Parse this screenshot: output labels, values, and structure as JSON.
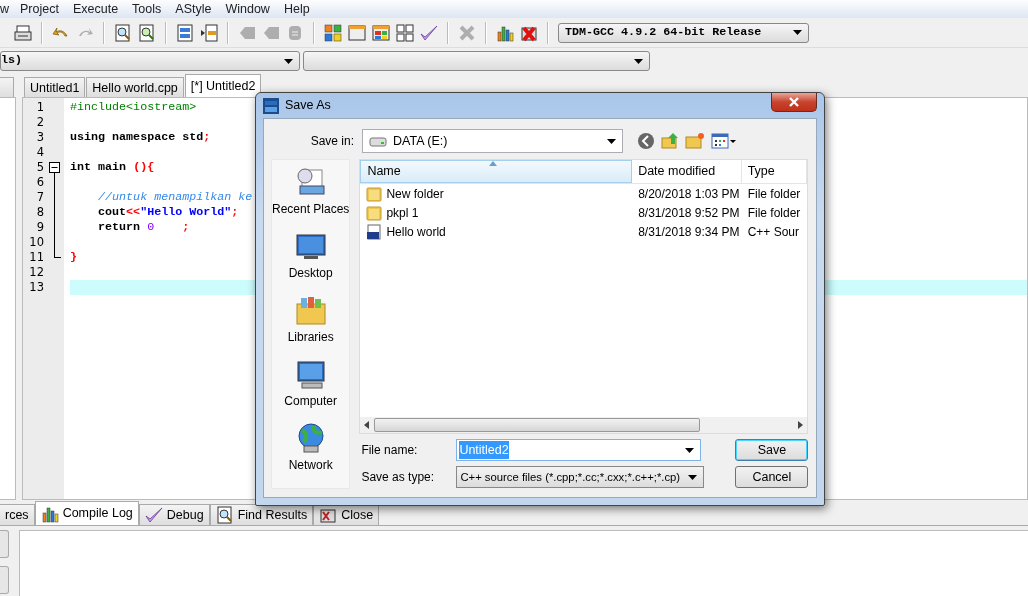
{
  "menu": [
    "w",
    "Project",
    "Execute",
    "Tools",
    "AStyle",
    "Window",
    "Help"
  ],
  "toolbar": [
    {
      "kind": "print",
      "disabled": false
    },
    {
      "kind": "sep"
    },
    {
      "kind": "undo",
      "disabled": false
    },
    {
      "kind": "redo",
      "disabled": true
    },
    {
      "kind": "sep"
    },
    {
      "kind": "find",
      "disabled": false
    },
    {
      "kind": "replace",
      "disabled": false
    },
    {
      "kind": "sep"
    },
    {
      "kind": "indent",
      "disabled": false
    },
    {
      "kind": "unindent",
      "disabled": false
    },
    {
      "kind": "sep"
    },
    {
      "kind": "bookmark",
      "disabled": true
    },
    {
      "kind": "goto",
      "disabled": true
    },
    {
      "kind": "comment",
      "disabled": true
    },
    {
      "kind": "sep"
    },
    {
      "kind": "tiles",
      "disabled": false
    },
    {
      "kind": "window",
      "disabled": false
    },
    {
      "kind": "colorwindow",
      "disabled": false
    },
    {
      "kind": "grid",
      "disabled": false
    },
    {
      "kind": "check",
      "disabled": false
    },
    {
      "kind": "sep"
    },
    {
      "kind": "delete",
      "disabled": true
    },
    {
      "kind": "sep"
    },
    {
      "kind": "chart",
      "disabled": false
    },
    {
      "kind": "stop",
      "disabled": false
    }
  ],
  "compiler": "TDM-GCC 4.9.2 64-bit Release",
  "class_select": "ls)",
  "editor_tabs": [
    {
      "label": "Untitled1",
      "selected": false
    },
    {
      "label": "Hello world.cpp",
      "selected": false
    },
    {
      "label": "[*] Untitled2",
      "selected": true
    }
  ],
  "code_lines": [
    {
      "number": "1",
      "kind": "plain",
      "current": false,
      "tokens": [
        {
          "kind": "preproc",
          "text": "#include<iostream>"
        }
      ]
    },
    {
      "number": "2",
      "kind": "plain",
      "current": false
    },
    {
      "number": "3",
      "kind": "plain",
      "current": false,
      "tokens": [
        {
          "kind": "plain",
          "text": "using namespace std"
        },
        {
          "kind": "symbol",
          "text": ";"
        }
      ]
    },
    {
      "number": "4",
      "kind": "plain",
      "current": false
    },
    {
      "number": "5",
      "kind": "foldstart",
      "current": false,
      "tokens": [
        {
          "kind": "plain",
          "text": "int main "
        },
        {
          "kind": "symbol",
          "text": "(){"
        }
      ]
    },
    {
      "number": "6",
      "kind": "foldinside",
      "current": false
    },
    {
      "number": "7",
      "kind": "foldinside",
      "current": false,
      "tokens": [
        {
          "kind": "comment",
          "text": "    //untuk menampilkan ke"
        }
      ]
    },
    {
      "number": "8",
      "kind": "foldinside",
      "current": false,
      "tokens": [
        {
          "kind": "plain",
          "text": "    cout"
        },
        {
          "kind": "symbol",
          "text": "<<"
        },
        {
          "kind": "string",
          "text": "\"Hello World\""
        },
        {
          "kind": "symbol",
          "text": ";"
        }
      ]
    },
    {
      "number": "9",
      "kind": "foldinside",
      "current": false,
      "tokens": [
        {
          "kind": "plain",
          "text": "    return "
        },
        {
          "kind": "number",
          "text": "0"
        },
        {
          "kind": "symbol",
          "text": "    ;"
        }
      ]
    },
    {
      "number": "10",
      "kind": "foldinside",
      "current": false
    },
    {
      "number": "11",
      "kind": "foldend",
      "current": false,
      "tokens": [
        {
          "kind": "symbol",
          "text": "}"
        }
      ]
    },
    {
      "number": "12",
      "kind": "plain",
      "current": false
    },
    {
      "number": "13",
      "kind": "plain",
      "current": true
    }
  ],
  "bottom_tabs": [
    {
      "label": "rces",
      "kind": "none",
      "selected": false
    },
    {
      "label": "Compile Log",
      "kind": "chart",
      "selected": true
    },
    {
      "label": "Debug",
      "kind": "check",
      "selected": false
    },
    {
      "label": "Find Results",
      "kind": "find",
      "selected": false
    },
    {
      "label": "Close",
      "kind": "close",
      "selected": false
    }
  ],
  "dialog": {
    "title": "Save As",
    "save_in_label": "Save in:",
    "save_in": "DATA (E:)",
    "places": [
      {
        "kind": "recent",
        "label": "Recent Places"
      },
      {
        "kind": "desktop",
        "label": "Desktop"
      },
      {
        "kind": "libraries",
        "label": "Libraries"
      },
      {
        "kind": "computer",
        "label": "Computer"
      },
      {
        "kind": "network",
        "label": "Network"
      }
    ],
    "columns": [
      {
        "label": "Name",
        "sorted": true
      },
      {
        "label": "Date modified",
        "sorted": false
      },
      {
        "label": "Type",
        "sorted": false
      }
    ],
    "files": [
      {
        "kind": "folder",
        "name": "New folder",
        "date": "8/20/2018 1:03 PM",
        "type": "File folder"
      },
      {
        "kind": "folder",
        "name": "pkpl 1",
        "date": "8/31/2018 9:52 PM",
        "type": "File folder"
      },
      {
        "kind": "cpp",
        "name": "Hello world",
        "date": "8/31/2018 9:34 PM",
        "type": "C++ Sour"
      }
    ],
    "file_name_label": "File name:",
    "file_name": "Untitled2",
    "file_name_selected": true,
    "save_type_label": "Save as type:",
    "save_type": "C++ source files (*.cpp;*.cc;*.cxx;*.c++;*.cp)",
    "buttons": [
      {
        "label": "Save",
        "default": true
      },
      {
        "label": "Cancel",
        "default": false
      }
    ]
  }
}
